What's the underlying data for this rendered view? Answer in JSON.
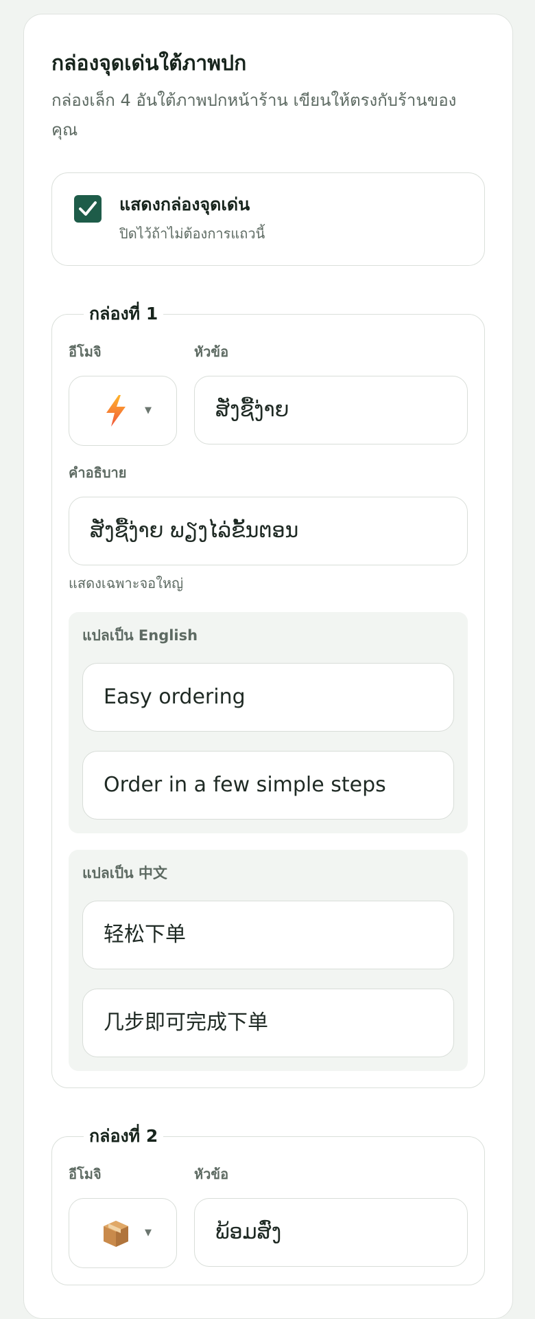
{
  "section": {
    "title": "กล่องจุดเด่นใต้ภาพปก",
    "description": "กล่องเล็ก 4 อันใต้ภาพปกหน้าร้าน เขียนให้ตรงกับร้านของคุณ"
  },
  "toggle": {
    "label": "แสดงกล่องจุดเด่น",
    "hint": "ปิดไว้ถ้าไม่ต้องการแถวนี้",
    "checked": true
  },
  "labels": {
    "emoji": "อีโมจิ",
    "title": "หัวข้อ",
    "description": "คำอธิบาย",
    "large_screen_only": "แสดงเฉพาะจอใหญ่",
    "translate_en": "แปลเป็น English",
    "translate_zh": "แปลเป็น 中文"
  },
  "features": [
    {
      "legend": "กล่องที่ 1",
      "emoji": "lightning-icon",
      "title": "ສັ່ງຊື້ງ່າຍ",
      "description": "ສັ່ງຊື້ງ່າຍ ພຽງໄລ່ຂັ້ນຕອນ",
      "en_title": "Easy ordering",
      "en_description": "Order in a few simple steps",
      "zh_title": "轻松下单",
      "zh_description": "几步即可完成下单"
    },
    {
      "legend": "กล่องที่ 2",
      "emoji": "package-icon",
      "title": "ພ້ອມສົ່ງ"
    }
  ],
  "colors": {
    "accent": "#1e5c49",
    "card_border": "#dfe3df",
    "translation_bg": "#f2f5f2"
  }
}
